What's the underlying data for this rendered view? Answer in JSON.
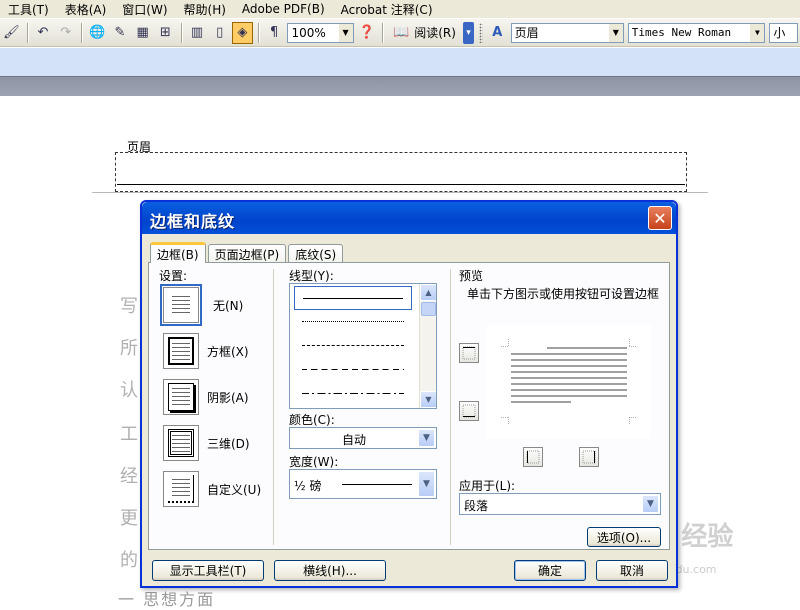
{
  "menubar": {
    "items": [
      "工具(T)",
      "表格(A)",
      "窗口(W)",
      "帮助(H)",
      "Adobe PDF(B)",
      "Acrobat 注释(C)"
    ]
  },
  "toolbar": {
    "zoom": "100%",
    "read_label": "阅读(R)",
    "style_value": "页眉",
    "font_value": "Times New Roman",
    "size_value": "小"
  },
  "document": {
    "header_label": "页眉",
    "left_chars": [
      "写",
      "所",
      "认",
      "工",
      "经",
      "更",
      "的"
    ],
    "bottom_text": "一  思想方面",
    "watermark": "Bai度 经验",
    "watermark_url": "jingyan.baidu.com"
  },
  "dialog": {
    "title": "边框和底纹",
    "tabs": [
      "边框(B)",
      "页面边框(P)",
      "底纹(S)"
    ],
    "settings_title": "设置:",
    "settings": [
      "无(N)",
      "方框(X)",
      "阴影(A)",
      "三维(D)",
      "自定义(U)"
    ],
    "style_label": "线型(Y):",
    "color_label": "颜色(C):",
    "color_value": "自动",
    "width_label": "宽度(W):",
    "width_value": "½ 磅",
    "preview_title": "预览",
    "preview_hint": "单击下方图示或使用按钮可设置边框",
    "apply_label": "应用于(L):",
    "apply_value": "段落",
    "options_button": "选项(O)...",
    "show_toolbar_button": "显示工具栏(T)",
    "horizontal_line_button": "横线(H)...",
    "ok_button": "确定",
    "cancel_button": "取消"
  }
}
